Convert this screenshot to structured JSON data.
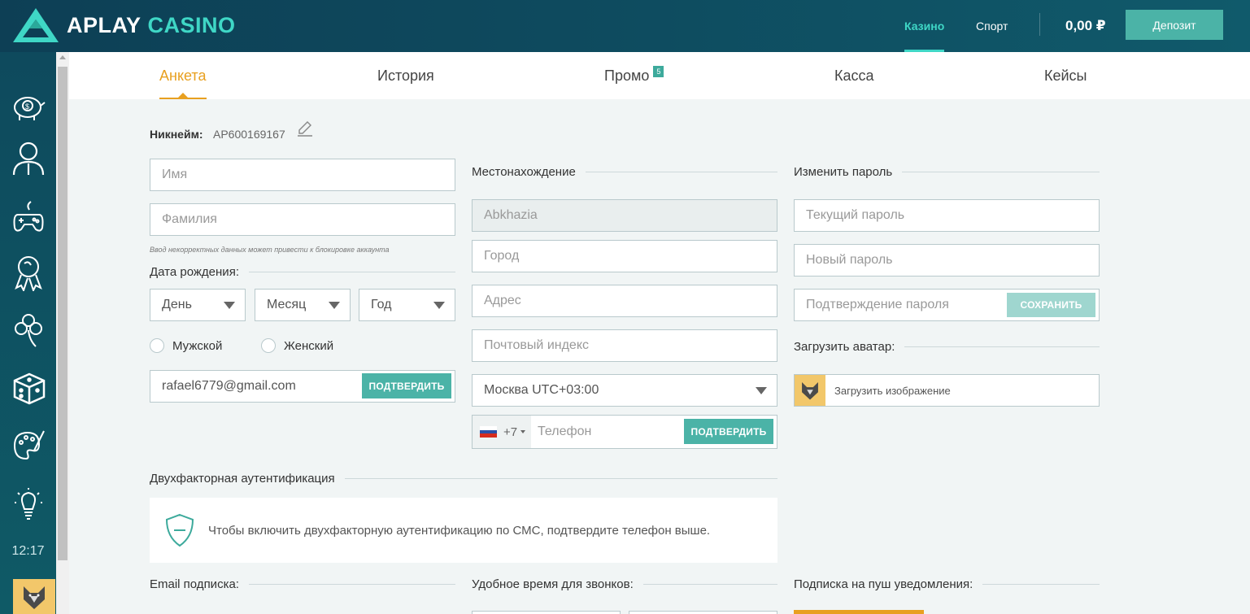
{
  "header": {
    "logo_word1": "APLAY",
    "logo_word2": "CASINO",
    "nav": [
      {
        "label": "Казино",
        "active": true
      },
      {
        "label": "Спорт",
        "active": false
      }
    ],
    "balance": "0,00 ₽",
    "deposit_label": "Депозит",
    "colors": {
      "accent": "#3fd7c6",
      "button": "#4bb3a7",
      "header_bg": "#0e4a5e"
    }
  },
  "sidebar": {
    "icons": [
      "piggy-bank-icon",
      "user-icon",
      "gamepad-icon",
      "medal-icon",
      "clover-icon",
      "dice-icon",
      "palette-icon",
      "lightbulb-icon"
    ],
    "time": "12:17"
  },
  "tabs": [
    {
      "label": "Анкета",
      "active": true
    },
    {
      "label": "История"
    },
    {
      "label": "Промо",
      "badge": "5"
    },
    {
      "label": "Касса"
    },
    {
      "label": "Кейсы"
    }
  ],
  "profile": {
    "nickname_label": "Никнейм:",
    "nickname_value": "AP600169167",
    "first_name_placeholder": "Имя",
    "last_name_placeholder": "Фамилия",
    "warning": "Ввод некорректных данных может привести к блокировке аккаунта",
    "birthdate_label": "Дата рождения:",
    "day": "День",
    "month": "Месяц",
    "year": "Год",
    "gender_male": "Мужской",
    "gender_female": "Женский",
    "email_value": "rafael6779@gmail.com",
    "email_confirm": "ПОДТВЕРДИТЬ"
  },
  "location": {
    "title": "Местонахождение",
    "country": "Abkhazia",
    "city_placeholder": "Город",
    "address_placeholder": "Адрес",
    "postcode_placeholder": "Почтовый индекс",
    "timezone": "Москва UTC+03:00",
    "phone_code": "+7",
    "phone_placeholder": "Телефон",
    "phone_confirm": "ПОДТВЕРДИТЬ"
  },
  "password": {
    "title": "Изменить пароль",
    "current_placeholder": "Текущий пароль",
    "new_placeholder": "Новый пароль",
    "confirm_placeholder": "Подтверждение пароля",
    "save_label": "СОХРАНИТЬ"
  },
  "avatar": {
    "title": "Загрузить аватар:",
    "upload_label": "Загрузить изображение"
  },
  "twofa": {
    "title": "Двухфакторная аутентификация",
    "text": "Чтобы включить двухфакторную аутентификацию по СМС, подтвердите телефон выше."
  },
  "bottom": {
    "email_sub": "Email подписка:",
    "call_time": "Удобное время для звонков:",
    "push_sub": "Подписка на пуш уведомления:"
  }
}
